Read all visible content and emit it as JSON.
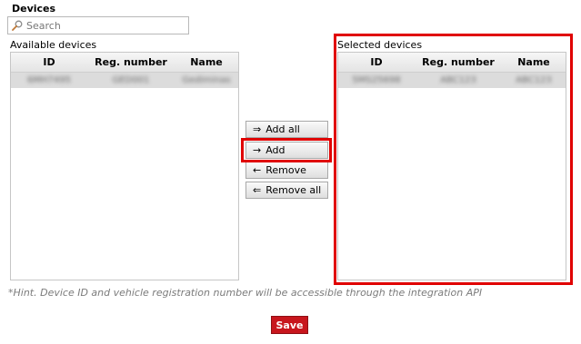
{
  "devices": {
    "title": "Devices",
    "search": {
      "placeholder": "Search",
      "value": ""
    },
    "available": {
      "label": "Available devices",
      "columns": [
        "ID",
        "Reg. number",
        "Name"
      ],
      "rows": [
        {
          "id": "6MH7495",
          "reg": "GED001",
          "name": "Gediminas"
        }
      ]
    },
    "buttons": {
      "add_all": "Add all",
      "add": "Add",
      "remove": "Remove",
      "remove_all": "Remove all"
    },
    "selected": {
      "label": "Selected devices",
      "columns": [
        "ID",
        "Reg. number",
        "Name"
      ],
      "rows": [
        {
          "id": "5MS25698",
          "reg": "ABC123",
          "name": "ABC123"
        }
      ]
    },
    "hint": "*Hint. Device ID and vehicle registration number will be accessible through the integration API",
    "save_label": "Save"
  },
  "colors": {
    "highlight": "#e00000",
    "save_bg": "#c8161d",
    "row_bg": "#dcdcdc"
  },
  "icons": {
    "search": "magnifier-icon",
    "add_all": "double-arrow-right-icon",
    "add": "arrow-right-icon",
    "remove": "arrow-left-icon",
    "remove_all": "double-arrow-left-icon"
  }
}
